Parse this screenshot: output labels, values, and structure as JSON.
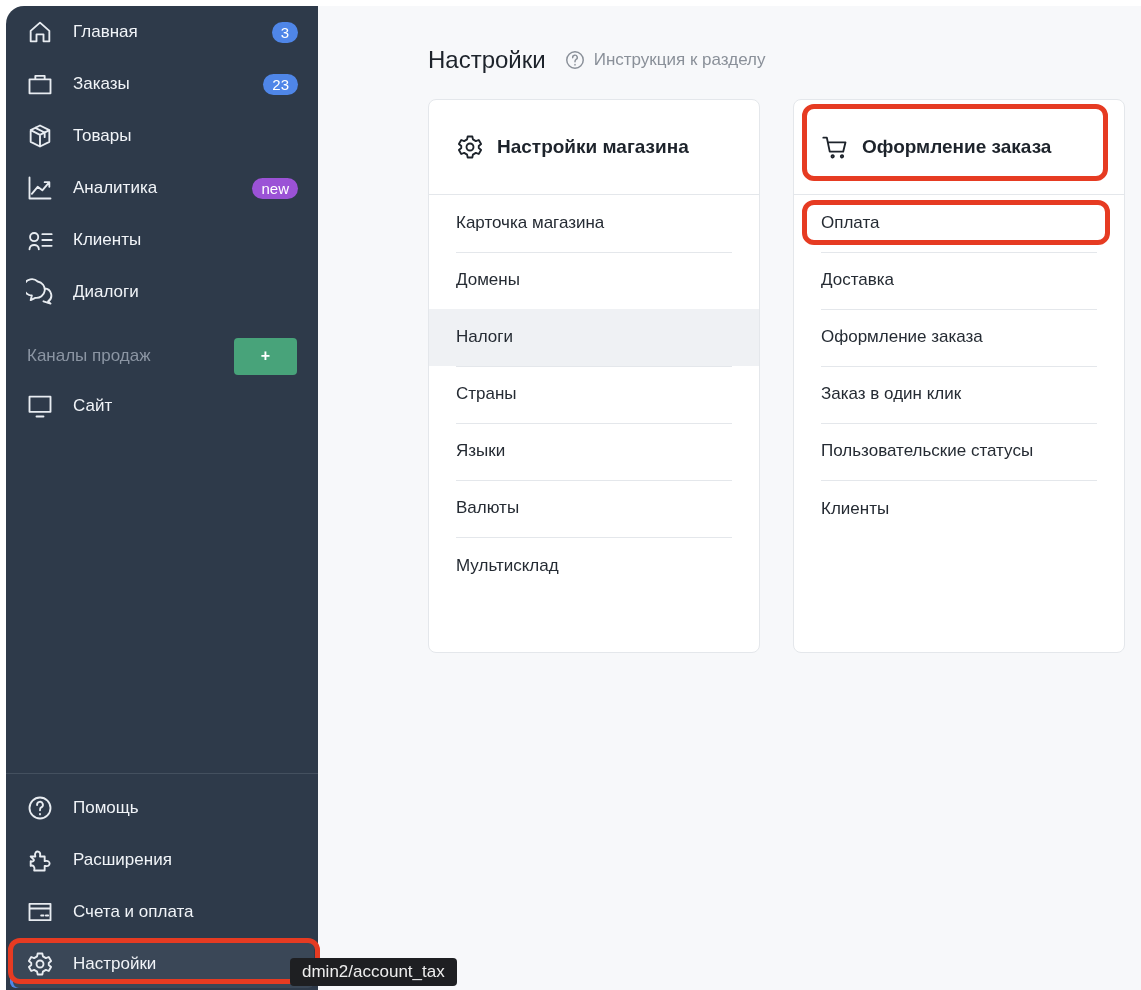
{
  "sidebar": {
    "items": [
      {
        "label": "Главная",
        "badge": "3",
        "color": "#4f86e8",
        "selected": false,
        "highlighted": false
      },
      {
        "label": "Заказы",
        "badge": "23",
        "color": "#4f86e8",
        "selected": false,
        "highlighted": false
      },
      {
        "label": "Товары",
        "selected": false,
        "highlighted": false
      },
      {
        "label": "Аналитика",
        "badge": "new",
        "color": "#9b52d6",
        "selected": false,
        "highlighted": false
      },
      {
        "label": "Клиенты",
        "selected": false,
        "highlighted": false
      },
      {
        "label": "Диалоги",
        "selected": false,
        "highlighted": false
      }
    ],
    "channels": {
      "title": "Каналы продаж",
      "add_button": "+",
      "items": [
        {
          "label": "Сайт",
          "selected": false,
          "highlighted": false
        }
      ]
    },
    "bottom_items": [
      {
        "label": "Помощь",
        "selected": false,
        "highlighted": false
      },
      {
        "label": "Расширения",
        "selected": false,
        "highlighted": false
      },
      {
        "label": "Счета и оплата",
        "selected": false,
        "highlighted": false
      },
      {
        "label": "Настройки",
        "selected": true,
        "highlighted": true
      }
    ]
  },
  "tooltip": "dmin2/account_tax",
  "page": {
    "title": "Настройки",
    "help_link": "Инструкция к разделу"
  },
  "cards": [
    {
      "title": "Настройки магазина",
      "highlighted": false,
      "items": [
        {
          "label": "Карточка магазина",
          "hovered": false,
          "highlighted": false
        },
        {
          "label": "Домены",
          "hovered": false,
          "highlighted": false
        },
        {
          "label": "Налоги",
          "hovered": true,
          "highlighted": false
        },
        {
          "label": "Страны",
          "hovered": false,
          "highlighted": false
        },
        {
          "label": "Языки",
          "hovered": false,
          "highlighted": false
        },
        {
          "label": "Валюты",
          "hovered": false,
          "highlighted": false
        },
        {
          "label": "Мультисклад",
          "hovered": false,
          "highlighted": false
        }
      ]
    },
    {
      "title": "Оформление заказа",
      "highlighted": true,
      "items": [
        {
          "label": "Оплата",
          "hovered": false,
          "highlighted": true
        },
        {
          "label": "Доставка",
          "hovered": false,
          "highlighted": false
        },
        {
          "label": "Оформление заказа",
          "hovered": false,
          "highlighted": false
        },
        {
          "label": "Заказ в один клик",
          "hovered": false,
          "highlighted": false
        },
        {
          "label": "Пользовательские статусы",
          "hovered": false,
          "highlighted": false
        },
        {
          "label": "Клиенты",
          "hovered": false,
          "highlighted": false
        }
      ]
    }
  ]
}
